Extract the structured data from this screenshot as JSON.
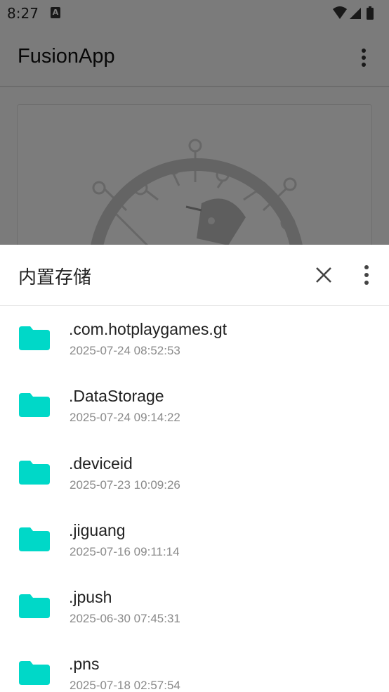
{
  "status_bar": {
    "time": "8:27",
    "notification_badge": "A"
  },
  "app": {
    "title": "FusionApp"
  },
  "sheet": {
    "title": "内置存储"
  },
  "files": [
    {
      "name": ".com.hotplaygames.gt",
      "date": "2025-07-24 08:52:53",
      "icon": "folder-icon"
    },
    {
      "name": ".DataStorage",
      "date": "2025-07-24 09:14:22",
      "icon": "folder-icon"
    },
    {
      "name": ".deviceid",
      "date": "2025-07-23 10:09:26",
      "icon": "folder-icon"
    },
    {
      "name": ".jiguang",
      "date": "2025-07-16 09:11:14",
      "icon": "folder-icon"
    },
    {
      "name": ".jpush",
      "date": "2025-06-30 07:45:31",
      "icon": "folder-icon"
    },
    {
      "name": ".pns",
      "date": "2025-07-18 02:57:54",
      "icon": "folder-icon"
    }
  ],
  "colors": {
    "folder": "#00d8c8",
    "scrim": "#000000"
  }
}
